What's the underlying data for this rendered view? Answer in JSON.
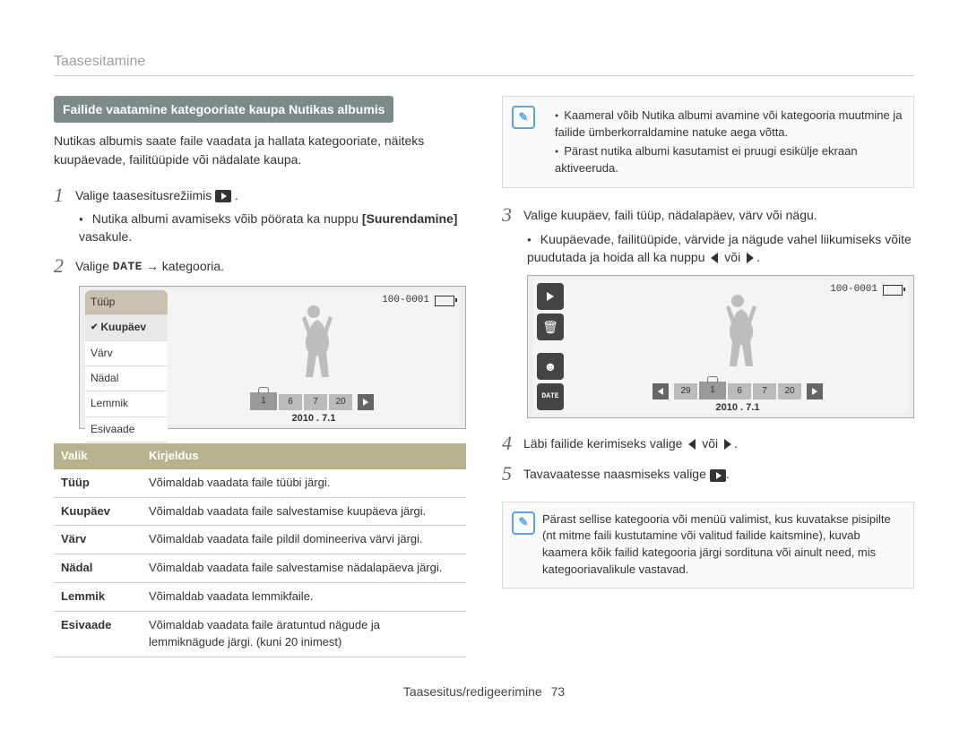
{
  "section_title": "Taasesitamine",
  "heading_badge": "Failide vaatamine kategooriate kaupa Nutikas albumis",
  "intro": "Nutikas albumis saate faile vaadata ja hallata kategooriate, näiteks kuupäevade, failitüüpide või nädalate kaupa.",
  "steps": {
    "s1": {
      "num": "1",
      "prefix": "Valige taasesitusrežiimis ",
      "suffix": "."
    },
    "s1_sub_a": "Nutika albumi avamiseks võib pöörata ka nuppu ",
    "s1_sub_b": "[Suurendamine]",
    "s1_sub_c": " vasakule.",
    "s2": {
      "num": "2",
      "prefix": "Valige ",
      "glyph": "DATE",
      "mid": " → kategooria."
    },
    "s3": {
      "num": "3",
      "text": "Valige kuupäev, faili tüüp, nädalapäev, värv või nägu."
    },
    "s3_sub_a": "Kuupäevade, failitüüpide, värvide ja nägude vahel liikumiseks võite puudutada ja hoida all ka nuppu ",
    "s3_sub_b": " või ",
    "s3_sub_c": ".",
    "s4": {
      "num": "4",
      "prefix": "Läbi failide kerimiseks valige ",
      "mid": " või ",
      "suffix": "."
    },
    "s5": {
      "num": "5",
      "prefix": "Tavavaatesse naasmiseks valige ",
      "suffix": "."
    }
  },
  "screen": {
    "menu": [
      "Tüüp",
      "Kuupäev",
      "Värv",
      "Nädal",
      "Lemmik",
      "Esivaade"
    ],
    "selected_index": 1,
    "counter": "100-0001",
    "thumbs_a": [
      "1",
      "6",
      "7",
      "20"
    ],
    "thumbs_b": [
      "29",
      "1",
      "6",
      "7",
      "20"
    ],
    "date": "2010 . 7.1"
  },
  "side_labels": {
    "play": "play",
    "trash": "trash",
    "face": "face",
    "date": "DATE"
  },
  "table": {
    "headers": [
      "Valik",
      "Kirjeldus"
    ],
    "rows": [
      [
        "Tüüp",
        "Võimaldab vaadata faile tüübi järgi."
      ],
      [
        "Kuupäev",
        "Võimaldab vaadata faile salvestamise kuupäeva järgi."
      ],
      [
        "Värv",
        "Võimaldab vaadata faile pildil domineeriva värvi järgi."
      ],
      [
        "Nädal",
        "Võimaldab vaadata faile salvestamise nädalapäeva järgi."
      ],
      [
        "Lemmik",
        "Võimaldab vaadata lemmikfaile."
      ],
      [
        "Esivaade",
        "Võimaldab vaadata faile äratuntud nägude ja lemmiknägude järgi. (kuni 20 inimest)"
      ]
    ]
  },
  "note1": [
    "Kaameral võib Nutika albumi avamine või kategooria muutmine ja failide ümberkorraldamine natuke aega võtta.",
    "Pärast nutika albumi kasutamist ei pruugi esikülje ekraan aktiveeruda."
  ],
  "note2": "Pärast sellise kategooria või menüü valimist, kus kuvatakse pisipilte (nt mitme faili kustutamine või valitud failide kaitsmine), kuvab kaamera kõik failid kategooria järgi sordituna või ainult need, mis kategooriavalikule vastavad.",
  "footer": {
    "label": "Taasesitus/redigeerimine",
    "page": "73"
  }
}
